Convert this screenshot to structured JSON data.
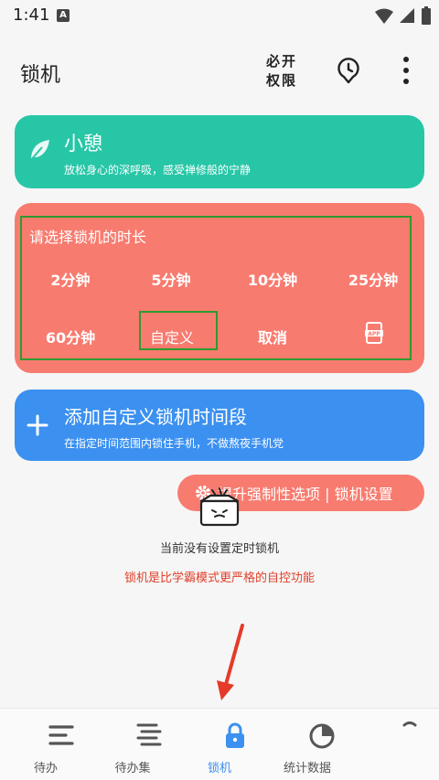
{
  "status_bar": {
    "time": "1:41",
    "notification_badge": "A"
  },
  "app_bar": {
    "title": "锁机",
    "permission_line1": "必开",
    "permission_line2": "权限",
    "clock_icon": "clock-pin-icon",
    "more_icon": "more-vert-icon"
  },
  "rest_card": {
    "title": "小憩",
    "subtitle": "放松身心的深呼吸，感受禅修般的宁静",
    "icon": "leaf-icon",
    "color": "#27c6a7"
  },
  "lock_card": {
    "title": "请选择锁机的时长",
    "options_row1": [
      "2分钟",
      "5分钟",
      "10分钟",
      "25分钟"
    ],
    "options_row2": [
      "60分钟",
      "自定义",
      "取消"
    ],
    "app_icon": "app-icon",
    "color": "#f87b6f"
  },
  "add_card": {
    "title": "添加自定义锁机时间段",
    "subtitle": "在指定时间范围内锁住手机，不做熬夜手机党",
    "icon": "plus-icon",
    "color": "#3b90f0"
  },
  "settings_pill": {
    "label": "提升强制性选项 | 锁机设置",
    "icon": "gear-icon"
  },
  "empty_state": {
    "message": "当前没有设置定时锁机",
    "warning": "锁机是比学霸模式更严格的自控功能",
    "warning_color": "#e0402a"
  },
  "bottom_nav": {
    "items": [
      {
        "label": "待办",
        "icon": "todo-list-icon"
      },
      {
        "label": "待办集",
        "icon": "todo-set-icon"
      },
      {
        "label": "锁机",
        "icon": "lock-icon",
        "active": true
      },
      {
        "label": "统计数据",
        "icon": "pie-chart-icon"
      },
      {
        "label": "",
        "icon": "profile-icon"
      }
    ],
    "active_color": "#3b90f0"
  }
}
